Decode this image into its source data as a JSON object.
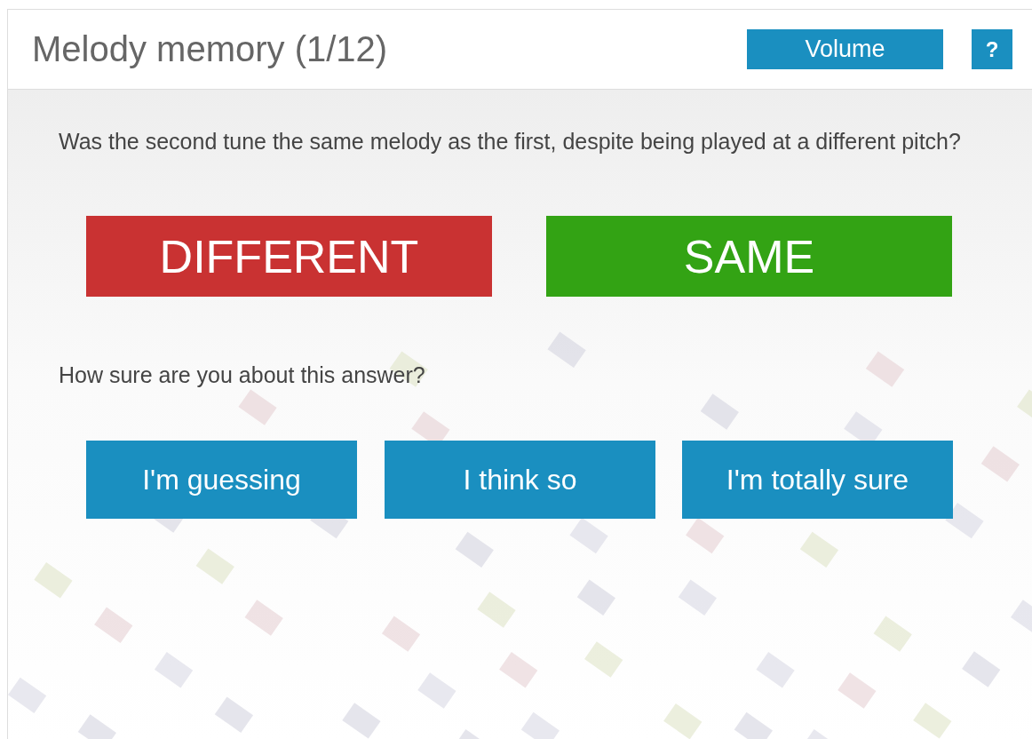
{
  "header": {
    "title": "Melody memory (1/12)",
    "volume_button": "Volume",
    "help_button": "?"
  },
  "question": "Was the second tune the same melody as the first, despite being played at a different pitch?",
  "answers": [
    {
      "label": "DIFFERENT",
      "color": "#c93232"
    },
    {
      "label": "SAME",
      "color": "#33a314"
    }
  ],
  "confidence_prompt": "How sure are you about this answer?",
  "confidence_options": [
    "I'm guessing",
    "I think so",
    "I'm totally sure"
  ]
}
